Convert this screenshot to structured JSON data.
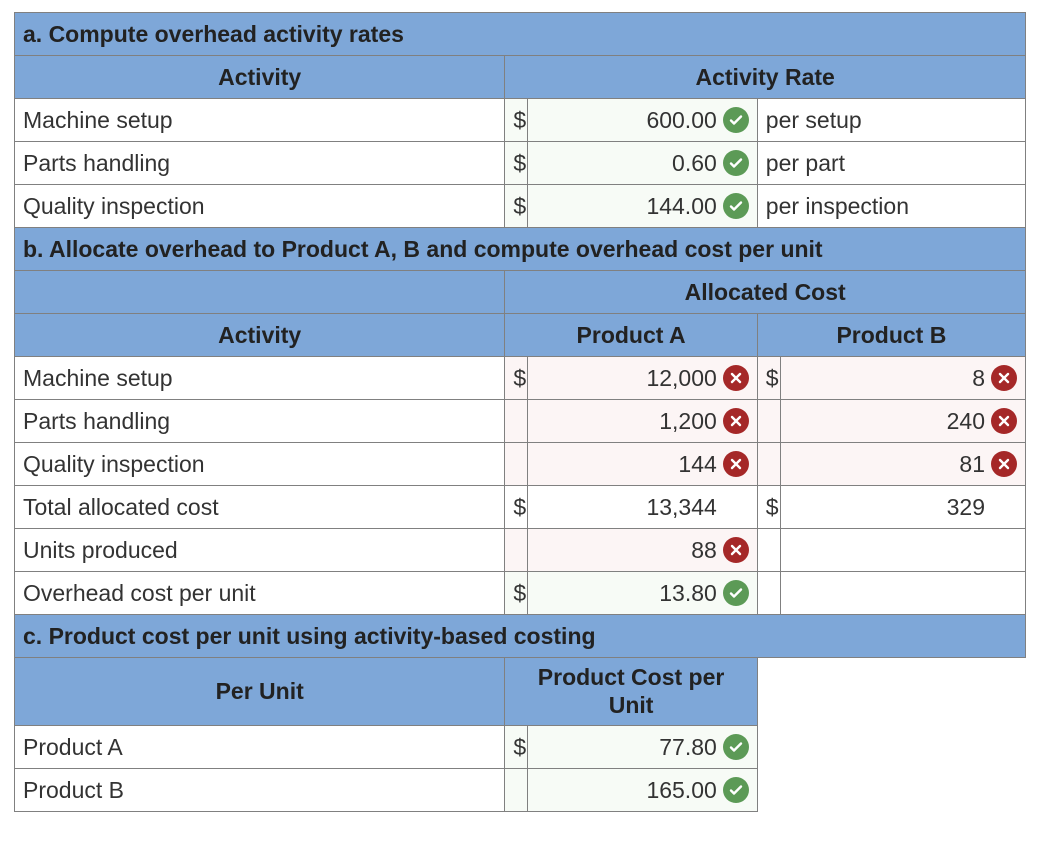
{
  "sectionA": {
    "title": "a. Compute overhead activity rates",
    "headers": {
      "activity": "Activity",
      "rate": "Activity Rate"
    },
    "rows": [
      {
        "activity": "Machine setup",
        "currency": "$",
        "value": "600.00",
        "status": "ok",
        "unit": "per setup"
      },
      {
        "activity": "Parts handling",
        "currency": "$",
        "value": "0.60",
        "status": "ok",
        "unit": "per part"
      },
      {
        "activity": "Quality inspection",
        "currency": "$",
        "value": "144.00",
        "status": "ok",
        "unit": "per inspection"
      }
    ]
  },
  "sectionB": {
    "title": "b. Allocate overhead to Product A, B and compute overhead cost per unit",
    "groupHeader": "Allocated Cost",
    "headers": {
      "activity": "Activity",
      "pa": "Product A",
      "pb": "Product B"
    },
    "rows": [
      {
        "activity": "Machine setup",
        "pa_cur": "$",
        "pa_val": "12,000",
        "pa_status": "bad",
        "pb_cur": "$",
        "pb_val": "8",
        "pb_status": "bad"
      },
      {
        "activity": "Parts handling",
        "pa_cur": "",
        "pa_val": "1,200",
        "pa_status": "bad",
        "pb_cur": "",
        "pb_val": "240",
        "pb_status": "bad"
      },
      {
        "activity": "Quality inspection",
        "pa_cur": "",
        "pa_val": "144",
        "pa_status": "bad",
        "pb_cur": "",
        "pb_val": "81",
        "pb_status": "bad"
      },
      {
        "activity": "Total allocated cost",
        "pa_cur": "$",
        "pa_val": "13,344",
        "pa_status": "",
        "pb_cur": "$",
        "pb_val": "329",
        "pb_status": ""
      },
      {
        "activity": "Units produced",
        "pa_cur": "",
        "pa_val": "88",
        "pa_status": "bad",
        "pb_cur": "",
        "pb_val": "",
        "pb_status": ""
      },
      {
        "activity": "Overhead cost per unit",
        "pa_cur": "$",
        "pa_val": "13.80",
        "pa_status": "ok",
        "pb_cur": "",
        "pb_val": "",
        "pb_status": ""
      }
    ]
  },
  "sectionC": {
    "title": "c. Product cost per unit using activity-based costing",
    "headers": {
      "per_unit": "Per Unit",
      "cost": "Product Cost per Unit"
    },
    "rows": [
      {
        "product": "Product A",
        "currency": "$",
        "value": "77.80",
        "status": "ok"
      },
      {
        "product": "Product B",
        "currency": "",
        "value": "165.00",
        "status": "ok"
      }
    ]
  }
}
